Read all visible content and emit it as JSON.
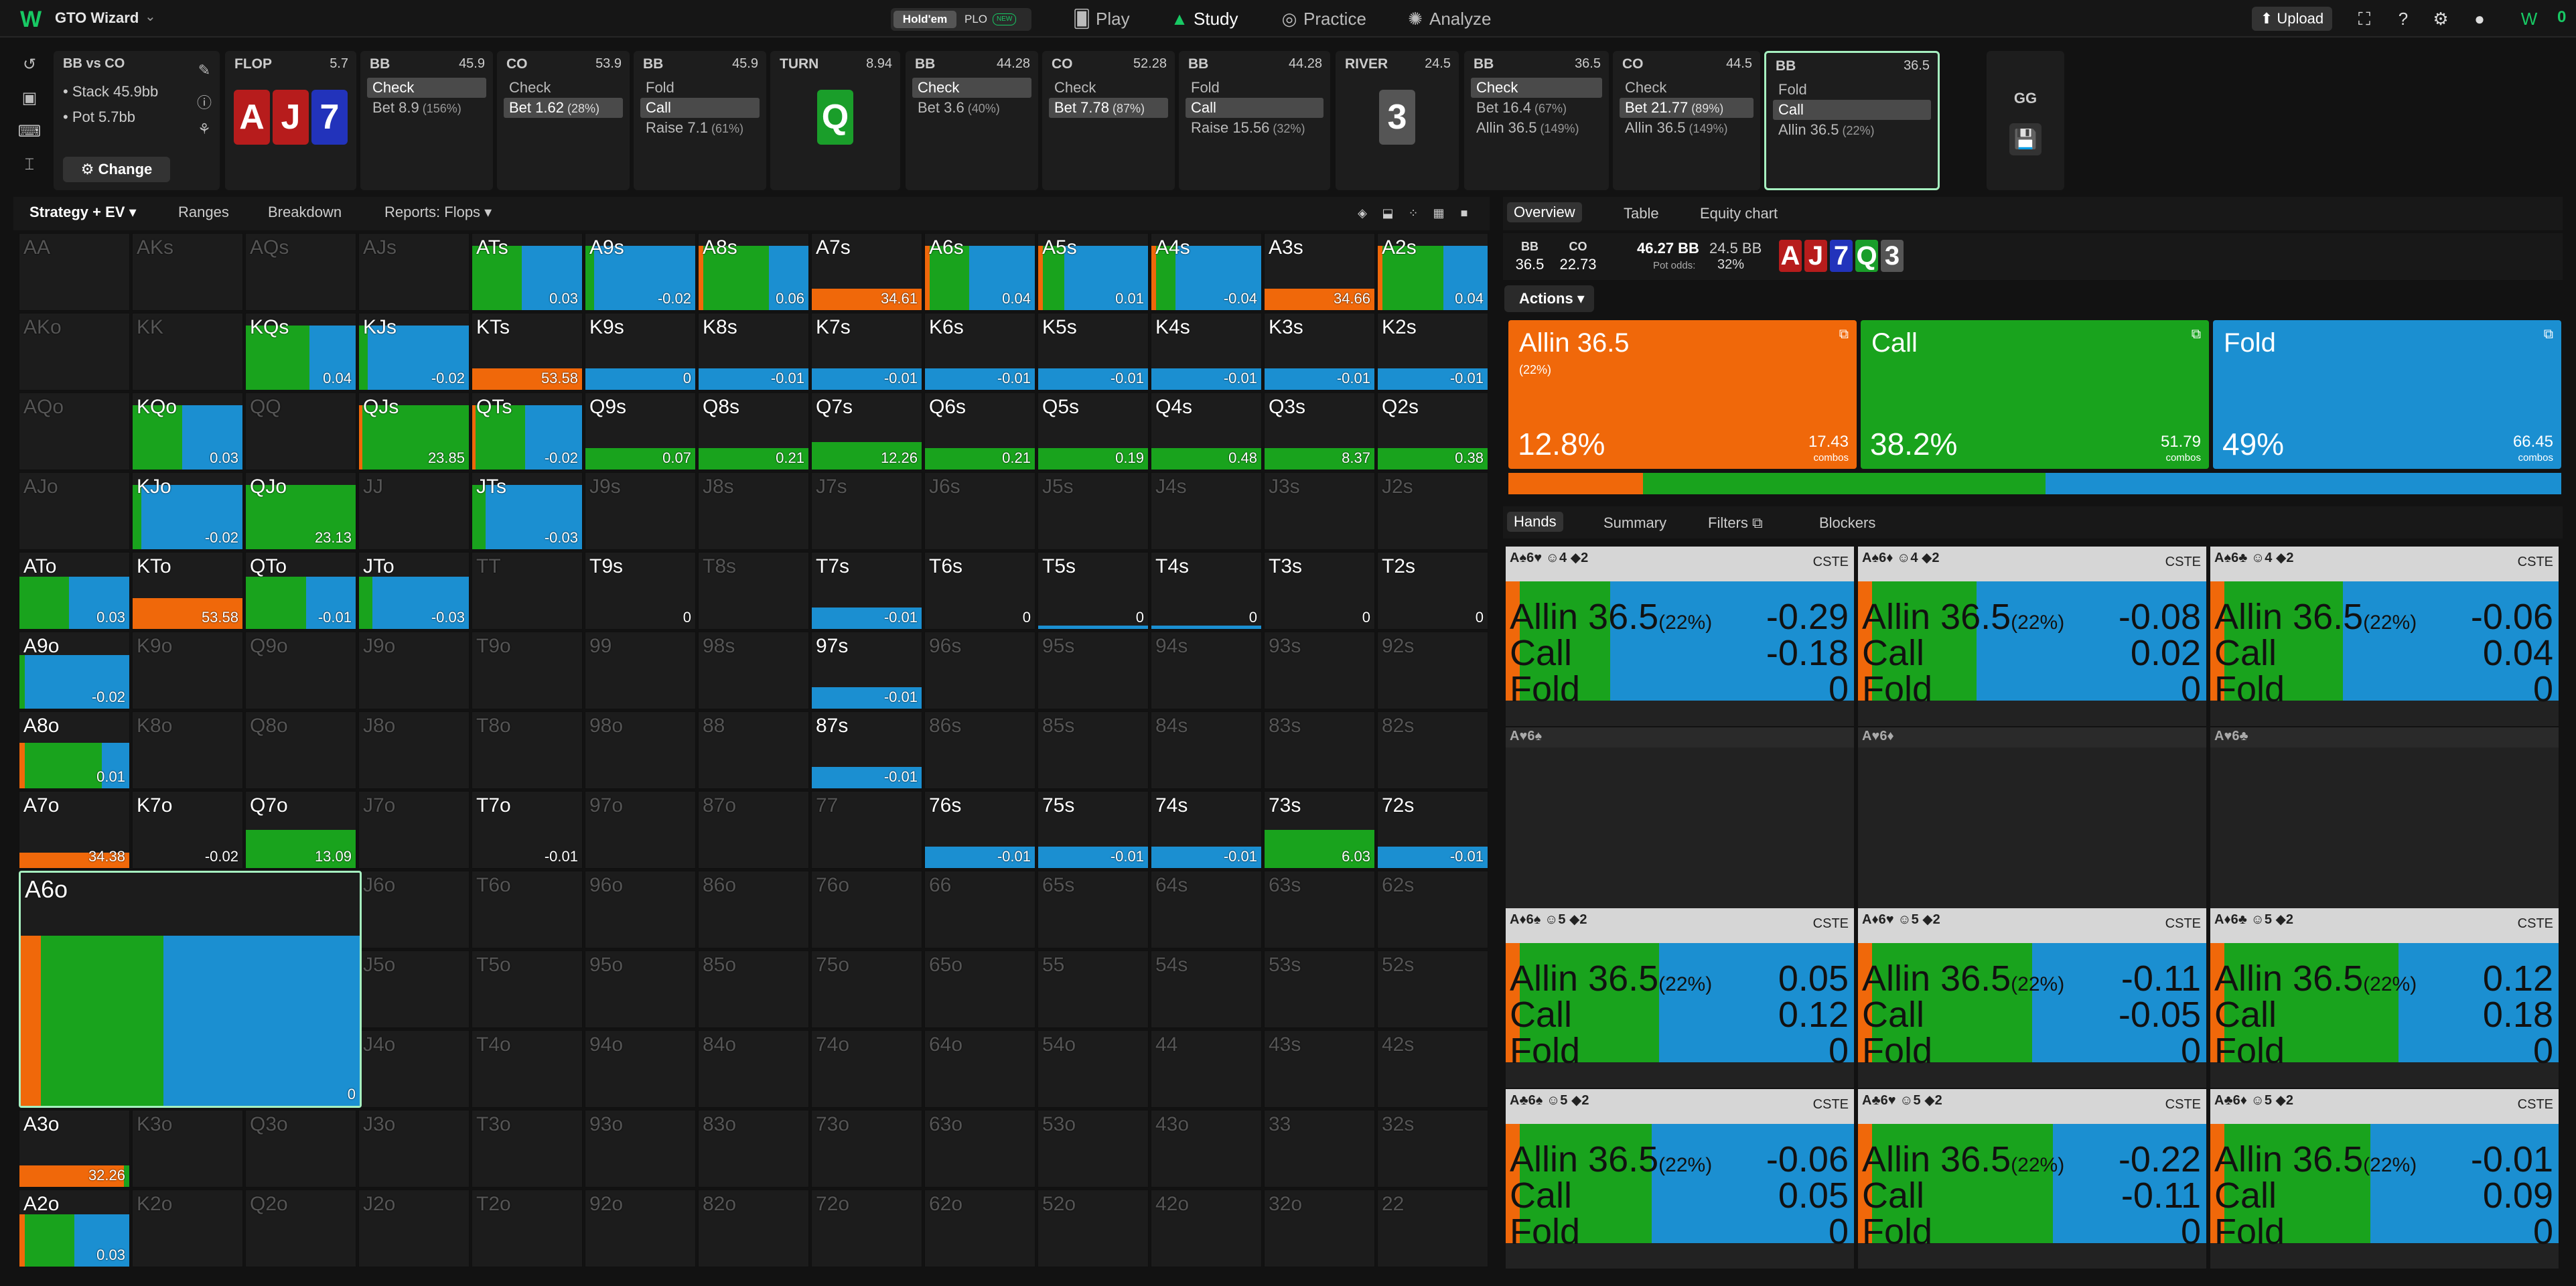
{
  "topbar": {
    "app_name": "GTO Wizard",
    "game_holdem": "Hold'em",
    "game_plo": "PLO",
    "game_plo_badge": "NEW",
    "nav": [
      {
        "label": "Play",
        "icon": "play-cards-icon",
        "active": false
      },
      {
        "label": "Study",
        "icon": "graduation-cap-icon",
        "active": true
      },
      {
        "label": "Practice",
        "icon": "gamepad-icon",
        "active": false
      },
      {
        "label": "Analyze",
        "icon": "bulb-icon",
        "active": false
      }
    ],
    "upload_label": "Upload",
    "balance": "0"
  },
  "info": {
    "title": "BB vs CO",
    "stack": "Stack 45.9bb",
    "pot": "Pot 5.7bb",
    "change_label": "Change"
  },
  "steps": [
    {
      "player": "FLOP",
      "size": "5.7",
      "cards": [
        {
          "r": "A",
          "c": "#b71c1c"
        },
        {
          "r": "J",
          "c": "#b71c1c"
        },
        {
          "r": "7",
          "c": "#2233bb"
        }
      ]
    },
    {
      "player": "BB",
      "size": "45.9",
      "options": [
        {
          "label": "Check",
          "pct": "",
          "sel": true
        },
        {
          "label": "Bet 8.9",
          "pct": "(156%)",
          "sel": false
        }
      ]
    },
    {
      "player": "CO",
      "size": "53.9",
      "options": [
        {
          "label": "Check",
          "pct": "",
          "sel": false
        },
        {
          "label": "Bet 1.62",
          "pct": "(28%)",
          "sel": true
        }
      ]
    },
    {
      "player": "BB",
      "size": "45.9",
      "options": [
        {
          "label": "Fold",
          "pct": "",
          "sel": false
        },
        {
          "label": "Call",
          "pct": "",
          "sel": true
        },
        {
          "label": "Raise 7.1",
          "pct": "(61%)",
          "sel": false
        }
      ]
    },
    {
      "player": "TURN",
      "size": "8.94",
      "cards": [
        {
          "r": "Q",
          "c": "#1a9e2a"
        }
      ]
    },
    {
      "player": "BB",
      "size": "44.28",
      "options": [
        {
          "label": "Check",
          "pct": "",
          "sel": true
        },
        {
          "label": "Bet 3.6",
          "pct": "(40%)",
          "sel": false
        }
      ]
    },
    {
      "player": "CO",
      "size": "52.28",
      "options": [
        {
          "label": "Check",
          "pct": "",
          "sel": false
        },
        {
          "label": "Bet 7.78",
          "pct": "(87%)",
          "sel": true
        }
      ]
    },
    {
      "player": "BB",
      "size": "44.28",
      "options": [
        {
          "label": "Fold",
          "pct": "",
          "sel": false
        },
        {
          "label": "Call",
          "pct": "",
          "sel": true
        },
        {
          "label": "Raise 15.56",
          "pct": "(32%)",
          "sel": false
        }
      ]
    },
    {
      "player": "RIVER",
      "size": "24.5",
      "cards": [
        {
          "r": "3",
          "c": "#555555"
        }
      ]
    },
    {
      "player": "BB",
      "size": "36.5",
      "options": [
        {
          "label": "Check",
          "pct": "",
          "sel": true
        },
        {
          "label": "Bet 16.4",
          "pct": "(67%)",
          "sel": false
        },
        {
          "label": "Allin 36.5",
          "pct": "(149%)",
          "sel": false
        }
      ]
    },
    {
      "player": "CO",
      "size": "44.5",
      "options": [
        {
          "label": "Check",
          "pct": "",
          "sel": false
        },
        {
          "label": "Bet 21.77",
          "pct": "(89%)",
          "sel": true
        },
        {
          "label": "Allin 36.5",
          "pct": "(149%)",
          "sel": false
        }
      ]
    },
    {
      "player": "BB",
      "size": "36.5",
      "active": true,
      "options": [
        {
          "label": "Fold",
          "pct": "",
          "sel": false
        },
        {
          "label": "Call",
          "pct": "",
          "sel": true
        },
        {
          "label": "Allin 36.5",
          "pct": "(22%)",
          "sel": false
        }
      ]
    }
  ],
  "gg_label": "GG",
  "left_tabs": [
    "Strategy + EV",
    "Ranges",
    "Breakdown",
    "Reports: Flops"
  ],
  "colors": {
    "allin": "#f0680a",
    "call": "#19a31d",
    "fold": "#1b8fd1",
    "empty": "#1c1c1c"
  },
  "grid": [
    [
      "AA",
      "",
      0,
      0,
      0
    ],
    [
      "AKs",
      "",
      0,
      0,
      0
    ],
    [
      "AQs",
      "",
      0,
      0,
      0
    ],
    [
      "AJs",
      "",
      0,
      0,
      0
    ],
    [
      "ATs",
      "0.03",
      0,
      0.45,
      0.55
    ],
    [
      "A9s",
      "-0.02",
      0,
      0.08,
      0.92
    ],
    [
      "A8s",
      "0.06",
      0.04,
      0.6,
      0.36
    ],
    [
      "A7s",
      "34.61",
      1,
      0,
      0
    ],
    [
      "A6s",
      "0.04",
      0.04,
      0.36,
      0.6
    ],
    [
      "A5s",
      "0.01",
      0.04,
      0.2,
      0.76
    ],
    [
      "A4s",
      "-0.04",
      0.04,
      0.18,
      0.78
    ],
    [
      "A3s",
      "34.66",
      1,
      0,
      0
    ],
    [
      "A2s",
      "0.04",
      0.04,
      0.56,
      0.4
    ],
    [
      "AKo",
      "",
      0,
      0,
      0
    ],
    [
      "KK",
      "",
      0,
      0,
      0
    ],
    [
      "KQs",
      "0.04",
      0,
      0.58,
      0.42
    ],
    [
      "KJs",
      "-0.02",
      0,
      0.08,
      0.92
    ],
    [
      "KTs",
      "53.58",
      1,
      0,
      0
    ],
    [
      "K9s",
      "0",
      0,
      0,
      1
    ],
    [
      "K8s",
      "-0.01",
      0,
      0,
      1
    ],
    [
      "K7s",
      "-0.01",
      0,
      0,
      1
    ],
    [
      "K6s",
      "-0.01",
      0,
      0,
      1
    ],
    [
      "K5s",
      "-0.01",
      0,
      0,
      1
    ],
    [
      "K4s",
      "-0.01",
      0,
      0,
      1
    ],
    [
      "K3s",
      "-0.01",
      0,
      0,
      1
    ],
    [
      "K2s",
      "-0.01",
      0,
      0,
      1
    ],
    [
      "AQo",
      "",
      0,
      0,
      0
    ],
    [
      "KQo",
      "0.03",
      0,
      0.45,
      0.55
    ],
    [
      "QQ",
      "",
      0,
      0,
      0
    ],
    [
      "QJs",
      "23.85",
      0.03,
      0.97,
      0
    ],
    [
      "QTs",
      "-0.02",
      0.03,
      0.45,
      0.52
    ],
    [
      "Q9s",
      "0.07",
      0,
      1,
      0
    ],
    [
      "Q8s",
      "0.21",
      0,
      1,
      0
    ],
    [
      "Q7s",
      "12.26",
      0,
      1,
      0
    ],
    [
      "Q6s",
      "0.21",
      0,
      1,
      0
    ],
    [
      "Q5s",
      "0.19",
      0,
      1,
      0
    ],
    [
      "Q4s",
      "0.48",
      0,
      1,
      0
    ],
    [
      "Q3s",
      "8.37",
      0,
      1,
      0
    ],
    [
      "Q2s",
      "0.38",
      0,
      1,
      0
    ],
    [
      "AJo",
      "",
      0,
      0,
      0
    ],
    [
      "KJo",
      "-0.02",
      0,
      0.08,
      0.92
    ],
    [
      "QJo",
      "23.13",
      0,
      1,
      0
    ],
    [
      "JJ",
      "",
      0,
      0,
      0
    ],
    [
      "JTs",
      "-0.03",
      0,
      0.12,
      0.88
    ],
    [
      "J9s",
      "",
      0,
      0,
      0
    ],
    [
      "J8s",
      "",
      0,
      0,
      0
    ],
    [
      "J7s",
      "",
      0,
      0,
      0
    ],
    [
      "J6s",
      "",
      0,
      0,
      0
    ],
    [
      "J5s",
      "",
      0,
      0,
      0
    ],
    [
      "J4s",
      "",
      0,
      0,
      0
    ],
    [
      "J3s",
      "",
      0,
      0,
      0
    ],
    [
      "J2s",
      "",
      0,
      0,
      0
    ],
    [
      "ATo",
      "0.03",
      0,
      0.45,
      0.55
    ],
    [
      "KTo",
      "53.58",
      1,
      0,
      0
    ],
    [
      "QTo",
      "-0.01",
      0,
      0.55,
      0.45
    ],
    [
      "JTo",
      "-0.03",
      0,
      0.12,
      0.88
    ],
    [
      "TT",
      "",
      0,
      0,
      0
    ],
    [
      "T9s",
      "0",
      0,
      0,
      0
    ],
    [
      "T8s",
      "",
      0,
      0,
      0
    ],
    [
      "T7s",
      "-0.01",
      0,
      0,
      1
    ],
    [
      "T6s",
      "0",
      0,
      0,
      0
    ],
    [
      "T5s",
      "0",
      0,
      0,
      1
    ],
    [
      "T4s",
      "0",
      0,
      0,
      1
    ],
    [
      "T3s",
      "0",
      0,
      0,
      0
    ],
    [
      "T2s",
      "0",
      0,
      0,
      0
    ],
    [
      "A9o",
      "-0.02",
      0,
      0.05,
      0.95
    ],
    [
      "K9o",
      "",
      0,
      0,
      0
    ],
    [
      "Q9o",
      "",
      0,
      0,
      0
    ],
    [
      "J9o",
      "",
      0,
      0,
      0
    ],
    [
      "T9o",
      "",
      0,
      0,
      0
    ],
    [
      "99",
      "",
      0,
      0,
      0
    ],
    [
      "98s",
      "",
      0,
      0,
      0
    ],
    [
      "97s",
      "-0.01",
      0,
      0,
      1
    ],
    [
      "96s",
      "",
      0,
      0,
      0
    ],
    [
      "95s",
      "",
      0,
      0,
      0
    ],
    [
      "94s",
      "",
      0,
      0,
      0
    ],
    [
      "93s",
      "",
      0,
      0,
      0
    ],
    [
      "92s",
      "",
      0,
      0,
      0
    ],
    [
      "A8o",
      "0.01",
      0.05,
      0.7,
      0.25
    ],
    [
      "K8o",
      "",
      0,
      0,
      0
    ],
    [
      "Q8o",
      "",
      0,
      0,
      0
    ],
    [
      "J8o",
      "",
      0,
      0,
      0
    ],
    [
      "T8o",
      "",
      0,
      0,
      0
    ],
    [
      "98o",
      "",
      0,
      0,
      0
    ],
    [
      "88",
      "",
      0,
      0,
      0
    ],
    [
      "87s",
      "-0.01",
      0,
      0,
      1
    ],
    [
      "86s",
      "",
      0,
      0,
      0
    ],
    [
      "85s",
      "",
      0,
      0,
      0
    ],
    [
      "84s",
      "",
      0,
      0,
      0
    ],
    [
      "83s",
      "",
      0,
      0,
      0
    ],
    [
      "82s",
      "",
      0,
      0,
      0
    ],
    [
      "A7o",
      "34.38",
      1,
      0,
      0
    ],
    [
      "K7o",
      "-0.02",
      0,
      0,
      0
    ],
    [
      "Q7o",
      "13.09",
      0,
      1,
      0
    ],
    [
      "J7o",
      "",
      0,
      0,
      0
    ],
    [
      "T7o",
      "-0.01",
      0,
      0,
      0
    ],
    [
      "97o",
      "",
      0,
      0,
      0
    ],
    [
      "87o",
      "",
      0,
      0,
      0
    ],
    [
      "77",
      "",
      0,
      0,
      0
    ],
    [
      "76s",
      "-0.01",
      0,
      0,
      1
    ],
    [
      "75s",
      "-0.01",
      0,
      0,
      1
    ],
    [
      "74s",
      "-0.01",
      0,
      0,
      1
    ],
    [
      "73s",
      "6.03",
      0,
      1,
      0
    ],
    [
      "72s",
      "-0.01",
      0,
      0,
      1
    ],
    [
      "A6o",
      "0",
      0.06,
      0.36,
      0.58
    ],
    [
      "K6o",
      "",
      0,
      0,
      0
    ],
    [
      "Q6o",
      "",
      0,
      0,
      0
    ],
    [
      "J6o",
      "",
      0,
      0,
      0
    ],
    [
      "T6o",
      "",
      0,
      0,
      0
    ],
    [
      "96o",
      "",
      0,
      0,
      0
    ],
    [
      "86o",
      "",
      0,
      0,
      0
    ],
    [
      "76o",
      "",
      0,
      0,
      0
    ],
    [
      "66",
      "",
      0,
      0,
      0
    ],
    [
      "65s",
      "",
      0,
      0,
      0
    ],
    [
      "64s",
      "",
      0,
      0,
      0
    ],
    [
      "63s",
      "",
      0,
      0,
      0
    ],
    [
      "62s",
      "",
      0,
      0,
      0
    ],
    [
      "A5o",
      "",
      0,
      0,
      0
    ],
    [
      "K5o",
      "",
      0,
      0,
      0
    ],
    [
      "Q5o",
      "",
      0,
      0,
      0
    ],
    [
      "J5o",
      "",
      0,
      0,
      0
    ],
    [
      "T5o",
      "",
      0,
      0,
      0
    ],
    [
      "95o",
      "",
      0,
      0,
      0
    ],
    [
      "85o",
      "",
      0,
      0,
      0
    ],
    [
      "75o",
      "",
      0,
      0,
      0
    ],
    [
      "65o",
      "",
      0,
      0,
      0
    ],
    [
      "55",
      "",
      0,
      0,
      0
    ],
    [
      "54s",
      "",
      0,
      0,
      0
    ],
    [
      "53s",
      "",
      0,
      0,
      0
    ],
    [
      "52s",
      "",
      0,
      0,
      0
    ],
    [
      "A4o",
      "",
      0,
      0,
      0
    ],
    [
      "K4o",
      "",
      0,
      0,
      0
    ],
    [
      "Q4o",
      "",
      0,
      0,
      0
    ],
    [
      "J4o",
      "",
      0,
      0,
      0
    ],
    [
      "T4o",
      "",
      0,
      0,
      0
    ],
    [
      "94o",
      "",
      0,
      0,
      0
    ],
    [
      "84o",
      "",
      0,
      0,
      0
    ],
    [
      "74o",
      "",
      0,
      0,
      0
    ],
    [
      "64o",
      "",
      0,
      0,
      0
    ],
    [
      "54o",
      "",
      0,
      0,
      0
    ],
    [
      "44",
      "",
      0,
      0,
      0
    ],
    [
      "43s",
      "",
      0,
      0,
      0
    ],
    [
      "42s",
      "",
      0,
      0,
      0
    ],
    [
      "A3o",
      "32.26",
      0.95,
      0.05,
      0
    ],
    [
      "K3o",
      "",
      0,
      0,
      0
    ],
    [
      "Q3o",
      "",
      0,
      0,
      0
    ],
    [
      "J3o",
      "",
      0,
      0,
      0
    ],
    [
      "T3o",
      "",
      0,
      0,
      0
    ],
    [
      "93o",
      "",
      0,
      0,
      0
    ],
    [
      "83o",
      "",
      0,
      0,
      0
    ],
    [
      "73o",
      "",
      0,
      0,
      0
    ],
    [
      "63o",
      "",
      0,
      0,
      0
    ],
    [
      "53o",
      "",
      0,
      0,
      0
    ],
    [
      "43o",
      "",
      0,
      0,
      0
    ],
    [
      "33",
      "",
      0,
      0,
      0
    ],
    [
      "32s",
      "",
      0,
      0,
      0
    ],
    [
      "A2o",
      "0.03",
      0.05,
      0.45,
      0.5
    ],
    [
      "K2o",
      "",
      0,
      0,
      0
    ],
    [
      "Q2o",
      "",
      0,
      0,
      0
    ],
    [
      "J2o",
      "",
      0,
      0,
      0
    ],
    [
      "T2o",
      "",
      0,
      0,
      0
    ],
    [
      "92o",
      "",
      0,
      0,
      0
    ],
    [
      "82o",
      "",
      0,
      0,
      0
    ],
    [
      "72o",
      "",
      0,
      0,
      0
    ],
    [
      "62o",
      "",
      0,
      0,
      0
    ],
    [
      "52o",
      "",
      0,
      0,
      0
    ],
    [
      "42o",
      "",
      0,
      0,
      0
    ],
    [
      "32o",
      "",
      0,
      0,
      0
    ],
    [
      "22",
      "",
      0,
      0,
      0
    ]
  ],
  "right_tabs": [
    "Overview",
    "Table",
    "Equity chart"
  ],
  "summary": {
    "p1": "BB",
    "p1v": "36.5",
    "p2": "CO",
    "p2v": "22.73",
    "pot": "46.27 BB",
    "call_amt": "24.5 BB",
    "potodds_label": "Pot odds:",
    "potodds": "32%",
    "board": [
      {
        "r": "A",
        "c": "#b71c1c"
      },
      {
        "r": "J",
        "c": "#b71c1c"
      },
      {
        "r": "7",
        "c": "#2233bb"
      },
      {
        "r": "Q",
        "c": "#1a9e2a"
      },
      {
        "r": "3",
        "c": "#555555"
      }
    ]
  },
  "actions_label": "Actions",
  "action_boxes": [
    {
      "name": "Allin 36.5",
      "sub": "(22%)",
      "pct": "12.8%",
      "combos": "17.43",
      "color": "#f0680a",
      "frac": 0.128
    },
    {
      "name": "Call",
      "sub": "",
      "pct": "38.2%",
      "combos": "51.79",
      "color": "#19a31d",
      "frac": 0.382
    },
    {
      "name": "Fold",
      "sub": "",
      "pct": "49%",
      "combos": "66.45",
      "color": "#1b8fd1",
      "frac": 0.49
    }
  ],
  "combos_label": "combos",
  "hand_tabs": [
    "Hands",
    "Summary",
    "Filters",
    "Blockers"
  ],
  "hands": [
    {
      "cards": "A♠6♥",
      "tags": "4 2",
      "cste": "CSTE",
      "allin": "-0.29",
      "call": "-0.18",
      "fold": "0",
      "mix": [
        0.04,
        0.26,
        0.7
      ]
    },
    {
      "cards": "A♠6♦",
      "tags": "4 2",
      "cste": "CSTE",
      "allin": "-0.08",
      "call": "0.02",
      "fold": "0",
      "mix": [
        0.04,
        0.3,
        0.66
      ]
    },
    {
      "cards": "A♠6♣",
      "tags": "4 2",
      "cste": "CSTE",
      "allin": "-0.06",
      "call": "0.04",
      "fold": "0",
      "mix": [
        0.04,
        0.34,
        0.62
      ]
    },
    {
      "cards": "A♥6♠",
      "empty": true
    },
    {
      "cards": "A♥6♦",
      "empty": true
    },
    {
      "cards": "A♥6♣",
      "empty": true
    },
    {
      "cards": "A♦6♠",
      "tags": "5 2",
      "cste": "CSTE",
      "allin": "0.05",
      "call": "0.12",
      "fold": "0",
      "mix": [
        0.04,
        0.4,
        0.56
      ]
    },
    {
      "cards": "A♦6♥",
      "tags": "5 2",
      "cste": "CSTE",
      "allin": "-0.11",
      "call": "-0.05",
      "fold": "0",
      "mix": [
        0.04,
        0.46,
        0.5
      ]
    },
    {
      "cards": "A♦6♣",
      "tags": "5 2",
      "cste": "CSTE",
      "allin": "0.12",
      "call": "0.18",
      "fold": "0",
      "mix": [
        0.04,
        0.5,
        0.46
      ]
    },
    {
      "cards": "A♣6♠",
      "tags": "5 2",
      "cste": "CSTE",
      "allin": "-0.06",
      "call": "0.05",
      "fold": "0",
      "mix": [
        0.04,
        0.38,
        0.58
      ]
    },
    {
      "cards": "A♣6♥",
      "tags": "5 2",
      "cste": "CSTE",
      "allin": "-0.22",
      "call": "-0.11",
      "fold": "0",
      "mix": [
        0.04,
        0.52,
        0.44
      ]
    },
    {
      "cards": "A♣6♦",
      "tags": "5 2",
      "cste": "CSTE",
      "allin": "-0.01",
      "call": "0.09",
      "fold": "0",
      "mix": [
        0.04,
        0.42,
        0.54
      ]
    }
  ],
  "hand_sub": "(22%)"
}
